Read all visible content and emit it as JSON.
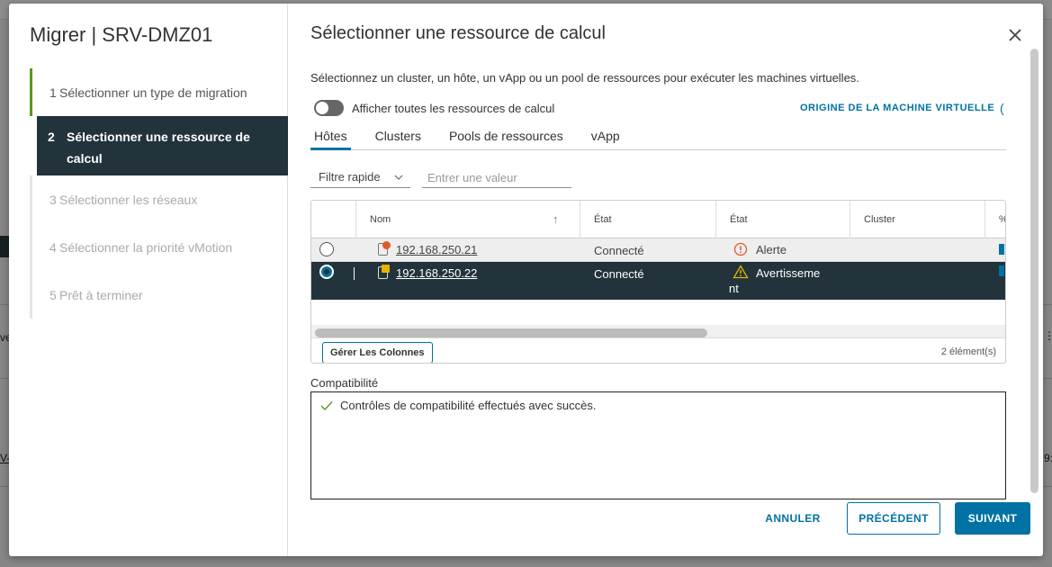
{
  "wizard": {
    "title": "Migrer | SRV-DMZ01",
    "steps": [
      {
        "num": "1",
        "label": "Sélectionner un type de migration",
        "state": "done"
      },
      {
        "num": "2",
        "label": "Sélectionner une ressource de calcul",
        "state": "active"
      },
      {
        "num": "3",
        "label": "Sélectionner les réseaux",
        "state": "todo"
      },
      {
        "num": "4",
        "label": "Sélectionner la priorité vMotion",
        "state": "todo"
      },
      {
        "num": "5",
        "label": "Prêt à terminer",
        "state": "todo"
      }
    ]
  },
  "page": {
    "title": "Sélectionner une ressource de calcul",
    "description": "Sélectionnez un cluster, un hôte, un vApp ou un pool de ressources pour exécuter les machines virtuelles.",
    "toggle_label": "Afficher toutes les ressources de calcul",
    "origin_link": "ORIGINE DE LA MACHINE VIRTUELLE",
    "origin_paren": "("
  },
  "tabs": [
    "Hôtes",
    "Clusters",
    "Pools de ressources",
    "vApp"
  ],
  "filter": {
    "select_value": "Filtre rapide",
    "input_placeholder": "Entrer une valeur"
  },
  "grid": {
    "columns": [
      "Nom",
      "État",
      "État",
      "Cluster",
      "%"
    ],
    "sort_arrow": "↑",
    "rows": [
      {
        "name": "192.168.250.21",
        "state": "Connecté",
        "status": "Alerte",
        "cluster": "",
        "selected": false
      },
      {
        "name": "192.168.250.22",
        "state": "Connecté",
        "status": "Avertisseme",
        "status_wrap": "nt",
        "cluster": "",
        "selected": true
      }
    ],
    "manage_columns": "Gérer Les Colonnes",
    "count": "2 élément(s)"
  },
  "compat": {
    "label": "Compatibilité",
    "message": "Contrôles de compatibilité effectués avec succès."
  },
  "buttons": {
    "cancel": "ANNULER",
    "previous": "PRÉCÉDENT",
    "next": "SUIVANT"
  },
  "background": {
    "fragment_left_1": "ve",
    "fragment_left_2": "V-",
    "fragment_right_1": "⋮",
    "fragment_right_2": "9:"
  },
  "colors": {
    "accent": "#0072a3",
    "nav_active": "#22333b",
    "step_done": "#5b9a1e",
    "alert": "#e05a2b",
    "warning": "#e6b400",
    "success": "#5b9a1e"
  }
}
